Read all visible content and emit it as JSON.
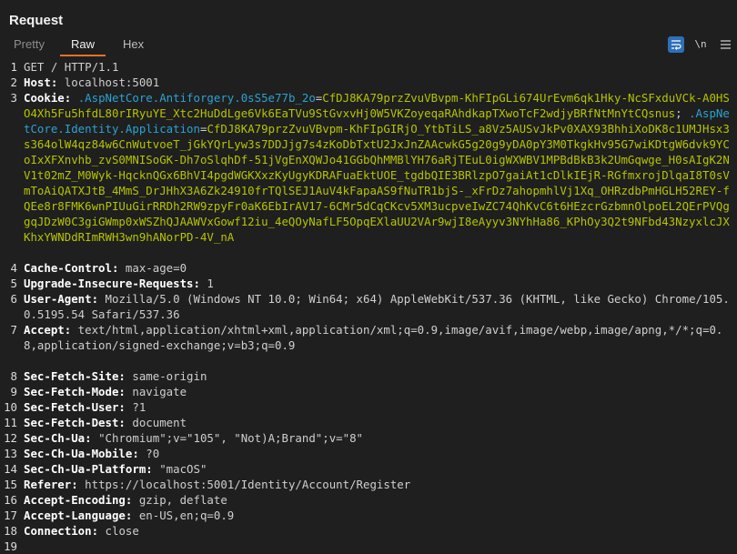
{
  "panel": {
    "title": "Request"
  },
  "tabs": [
    {
      "label": "Pretty"
    },
    {
      "label": "Raw",
      "active": true
    },
    {
      "label": "Hex"
    }
  ],
  "toolbar": {
    "wrap_icon": "wrap-lines-icon",
    "newline_label": "\\n",
    "menu_icon": "hamburger-menu-icon"
  },
  "colors": {
    "header_name": "#ffffff",
    "cookie_name": "#2aa3cf",
    "cookie_value": "#b5c400",
    "active_tab_underline": "#e8712c",
    "wrap_button_bg": "#2f6fb7"
  },
  "request": {
    "line1": "GET / HTTP/1.1",
    "host_name": "Host:",
    "host_value": " localhost:5001",
    "cookie_name": "Cookie:",
    "cookie1_name": ".AspNetCore.Antiforgery.0sS5e77b_2o",
    "cookie1_value": "CfDJ8KA79przZvuVBvpm-KhFIpGLi674UrEvm6qk1Hky-NcSFxduVCk-A0HSO4Xh5Fu5hfdL80rIRyuYE_Xtc2HuDdLge6Vk6EaTVu9StGvxvHj0W5VKZoyeqaRAhdkapTXwoTcF2wdjyBRfNtMnYtCQsnus",
    "cookie2_name": ".AspNetCore.Identity.Application",
    "cookie2_value": "CfDJ8KA79przZvuVBvpm-KhFIpGIRjO_YtbTiLS_a8Vz5AUSvJkPv0XAX93BhhiXoDK8c1UMJHsx3s364olW4qz84w6CnWutvoeT_jGkYQrLyw3s7DDJjg7s4zKoDbTxtU2JxJnZAAcwkG5g20g9yDA0pY3M0TkgkHv95G7wiKDtgW6dvk9YCoIxXFXnvhb_zvS0MNISoGK-Dh7oSlqhDf-51jVgEnXQWJo41GGbQhMMBlYH76aRjTEuL0igWXWBV1MPBdBkB3k2UmGqwge_H0sAIgK2NV1t02mZ_M0Wyk-HqcknQGx6BhVI4pgdWGKXxzKyUgyKDRAFuaEktUOE_tgdbQIE3BRlzpO7gaiAt1cDlkIEjR-RGfmxrojDlqaI8T0sVmToAiQATXJtB_4MmS_DrJHhX3A6Zk24910frTQlSEJ1AuV4kFapaAS9fNuTR1bjS-_xFrDz7ahopmhlVj1Xq_OHRzdbPmHGLH52REY-fQEe8r8FMK6wnPIUuGirRRDh2RW9zpyFr0aK6EbIrAV17-6CMr5dCqCKcv5XM3ucpveIwZC74QhKvC6t6HEzcrGzbmnOlpoEL2QErPVQggqJDzW0C3giGWmp0xWSZhQJAAWVxGowf12iu_4eQOyNafLF5OpqEXlaUU2VAr9wjI8eAyyv3NYhHa86_KPhOy3Q2t9NFbd43NzyxlcJXKhxYWNDdRImRWH3wn9hANorPD-4V_nA",
    "headers": [
      {
        "name": "Cache-Control:",
        "value": " max-age=0"
      },
      {
        "name": "Upgrade-Insecure-Requests:",
        "value": " 1"
      },
      {
        "name": "User-Agent:",
        "value": " Mozilla/5.0 (Windows NT 10.0; Win64; x64) AppleWebKit/537.36 (KHTML, like Gecko) Chrome/105.0.5195.54 Safari/537.36"
      },
      {
        "name": "Accept:",
        "value": " text/html,application/xhtml+xml,application/xml;q=0.9,image/avif,image/webp,image/apng,*/*;q=0.8,application/signed-exchange;v=b3;q=0.9"
      },
      {
        "name": "Sec-Fetch-Site:",
        "value": " same-origin"
      },
      {
        "name": "Sec-Fetch-Mode:",
        "value": " navigate"
      },
      {
        "name": "Sec-Fetch-User:",
        "value": " ?1"
      },
      {
        "name": "Sec-Fetch-Dest:",
        "value": " document"
      },
      {
        "name": "Sec-Ch-Ua:",
        "value": " \"Chromium\";v=\"105\", \"Not)A;Brand\";v=\"8\""
      },
      {
        "name": "Sec-Ch-Ua-Mobile:",
        "value": " ?0"
      },
      {
        "name": "Sec-Ch-Ua-Platform:",
        "value": " \"macOS\""
      },
      {
        "name": "Referer:",
        "value": " https://localhost:5001/Identity/Account/Register"
      },
      {
        "name": "Accept-Encoding:",
        "value": " gzip, deflate"
      },
      {
        "name": "Accept-Language:",
        "value": " en-US,en;q=0.9"
      },
      {
        "name": "Connection:",
        "value": " close"
      }
    ]
  },
  "line_numbers": [
    "1",
    "2",
    "3",
    "4",
    "5",
    "6",
    "7",
    "8",
    "9",
    "10",
    "11",
    "12",
    "13",
    "14",
    "15",
    "16",
    "17",
    "18",
    "19"
  ]
}
